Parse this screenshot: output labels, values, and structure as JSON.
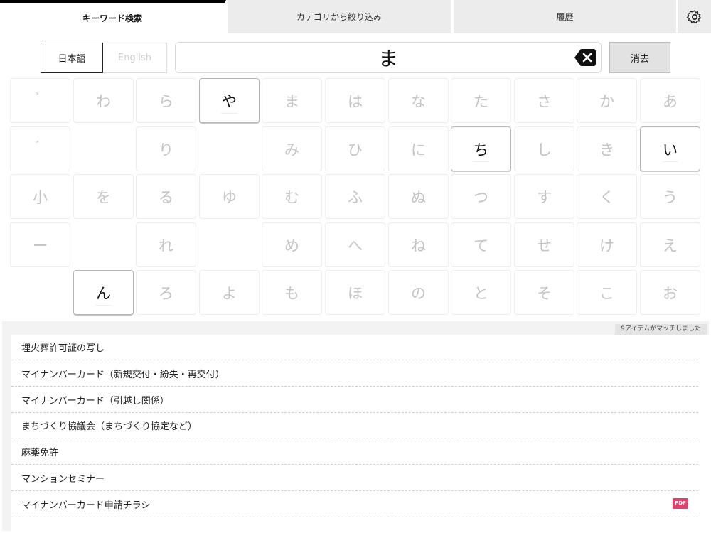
{
  "tabs": {
    "keyword": "キーワード検索",
    "category": "カテゴリから絞り込み",
    "history": "履歴"
  },
  "icons": {
    "settings": "gear-icon",
    "backspace": "backspace-icon",
    "pdf": "pdf-icon"
  },
  "language": {
    "japanese": "日本語",
    "english": "English",
    "selected": "日本語"
  },
  "search": {
    "value": "ま",
    "clear_label": "消去"
  },
  "keyboard": {
    "rows": [
      [
        "゜",
        "わ",
        "ら",
        "や",
        "ま",
        "は",
        "な",
        "た",
        "さ",
        "か",
        "あ"
      ],
      [
        "゛",
        "",
        "り",
        "",
        "み",
        "ひ",
        "に",
        "ち",
        "し",
        "き",
        "い"
      ],
      [
        "小",
        "を",
        "る",
        "ゆ",
        "む",
        "ふ",
        "ぬ",
        "つ",
        "す",
        "く",
        "う"
      ],
      [
        "ー",
        "",
        "れ",
        "",
        "め",
        "へ",
        "ね",
        "て",
        "せ",
        "け",
        "え"
      ],
      [
        "",
        "ん",
        "ろ",
        "よ",
        "も",
        "ほ",
        "の",
        "と",
        "そ",
        "こ",
        "お"
      ]
    ],
    "enabled_keys": [
      "や",
      "ち",
      "い",
      "ん"
    ]
  },
  "results": {
    "match_count_text": "9アイテムがマッチしました",
    "items": [
      {
        "title": "埋火葬許可証の写し",
        "pdf": false
      },
      {
        "title": "マイナンバーカード（新規交付・紛失・再交付）",
        "pdf": false
      },
      {
        "title": "マイナンバーカード（引越し関係）",
        "pdf": false
      },
      {
        "title": "まちづくり協議会（まちづくり協定など）",
        "pdf": false
      },
      {
        "title": "麻薬免許",
        "pdf": false
      },
      {
        "title": "マンションセミナー",
        "pdf": false
      },
      {
        "title": "マイナンバーカード申請チラシ",
        "pdf": true,
        "pdf_label": "PDF"
      }
    ]
  },
  "colors": {
    "active_tab_indicator": "#000000",
    "pdf_badge": "#d9456b",
    "disabled_key_text": "#c4c4c4"
  }
}
